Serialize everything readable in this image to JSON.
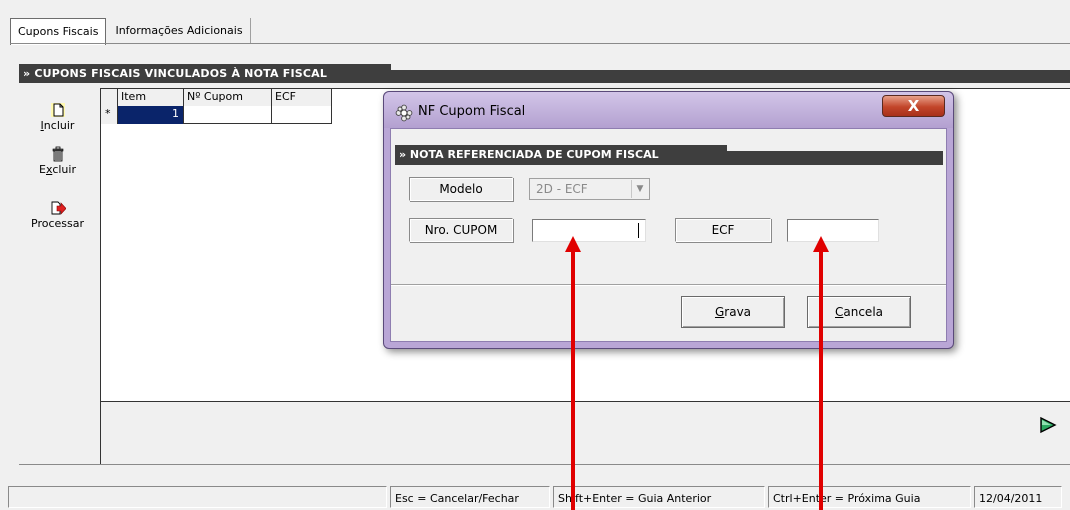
{
  "tabs": [
    {
      "label": "Cupons Fiscais",
      "active": true
    },
    {
      "label": "Informações Adicionais",
      "active": false
    }
  ],
  "section_title": "» CUPONS FISCAIS VINCULADOS À NOTA FISCAL",
  "toolbar": {
    "incluir_label": "Incluir",
    "incluir_accel": "I",
    "incluir_rest": "ncluir",
    "excluir_pre": "E",
    "excluir_accel": "x",
    "excluir_rest": "cluir",
    "processar_label": "Processar"
  },
  "grid": {
    "headers": [
      "Item",
      "Nº Cupom",
      "ECF"
    ],
    "row_marker": "*",
    "rows": [
      {
        "item": "1",
        "cupom": "",
        "ecf": ""
      }
    ]
  },
  "statusbar": {
    "panel0": "",
    "panel1": "Esc = Cancelar/Fechar",
    "panel2": "Shift+Enter = Guia Anterior",
    "panel3": "Ctrl+Enter = Próxima Guia",
    "panel4": "12/04/2011"
  },
  "dialog": {
    "title": "NF Cupom Fiscal",
    "close_glyph": "X",
    "section_title": "» NOTA REFERENCIADA DE CUPOM FISCAL",
    "modelo_label": "Modelo",
    "modelo_value": "2D - ECF",
    "nro_cupom_label": "Nro. CUPOM",
    "nro_cupom_value": "",
    "ecf_label": "ECF",
    "ecf_value": "",
    "grava_accel": "G",
    "grava_rest": "rava",
    "cancela_accel": "C",
    "cancela_rest": "ancela"
  },
  "colors": {
    "section_bg": "#3e3e3e",
    "dialog_frame": "#b9a6d6",
    "selected_cell": "#0a246a",
    "annotation_arrow": "#e00000",
    "close_button": "#c2452a"
  },
  "icons": {
    "incluir": "new-document-icon",
    "excluir": "trash-bin-icon",
    "processar": "process-arrow-icon",
    "next_tab": "next-arrow-icon",
    "dialog": "gear-flower-icon"
  }
}
